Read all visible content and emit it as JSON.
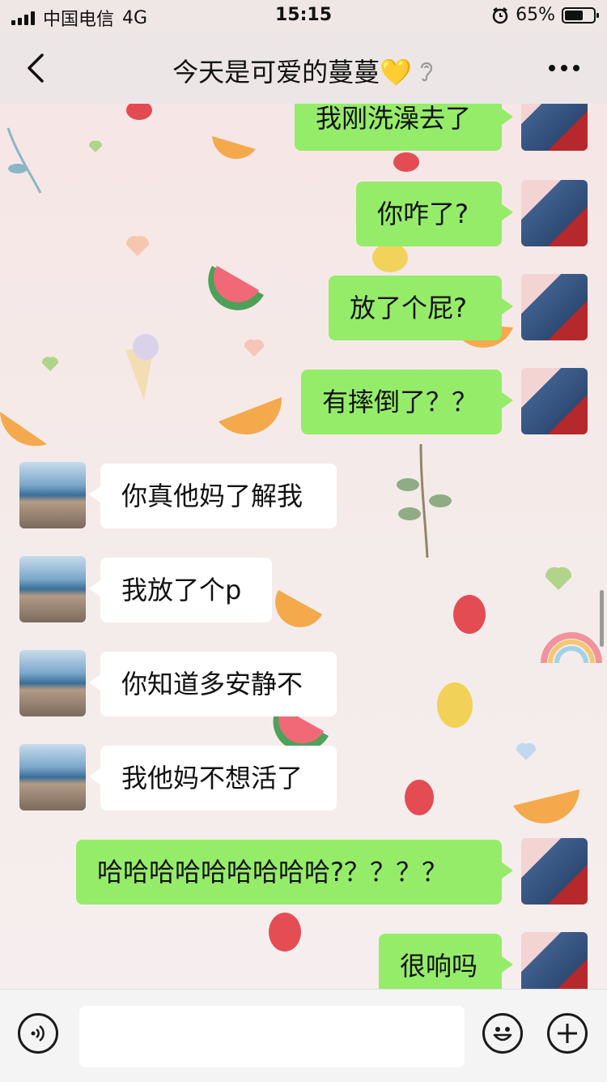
{
  "status_bar": {
    "carrier": "中国电信",
    "network": "4G",
    "time": "15:15",
    "battery_percent": "65%",
    "battery_level": 0.65
  },
  "nav": {
    "back_icon": "chevron-left-icon",
    "title": "今天是可爱的蔓蔓💛",
    "title_icon": "ear-icon",
    "more_icon": "more-dots-icon"
  },
  "messages": [
    {
      "sender": "me",
      "text": "我刚洗澡去了"
    },
    {
      "sender": "me",
      "text": "你咋了?"
    },
    {
      "sender": "me",
      "text": "放了个屁?"
    },
    {
      "sender": "me",
      "text": "有摔倒了？？"
    },
    {
      "sender": "friend",
      "text": "你真他妈了解我"
    },
    {
      "sender": "friend",
      "text": "我放了个p"
    },
    {
      "sender": "friend",
      "text": "你知道多安静不"
    },
    {
      "sender": "friend",
      "text": "我他妈不想活了"
    },
    {
      "sender": "me",
      "text": "哈哈哈哈哈哈哈哈哈?？？？？"
    },
    {
      "sender": "me",
      "text": "很响吗"
    }
  ],
  "input_bar": {
    "voice_icon": "voice-icon",
    "input_value": "",
    "emoji_icon": "emoji-icon",
    "plus_icon": "plus-icon"
  },
  "colors": {
    "my_bubble": "#95ec69",
    "friend_bubble": "#ffffff",
    "chat_background": "#f4e8e8"
  }
}
